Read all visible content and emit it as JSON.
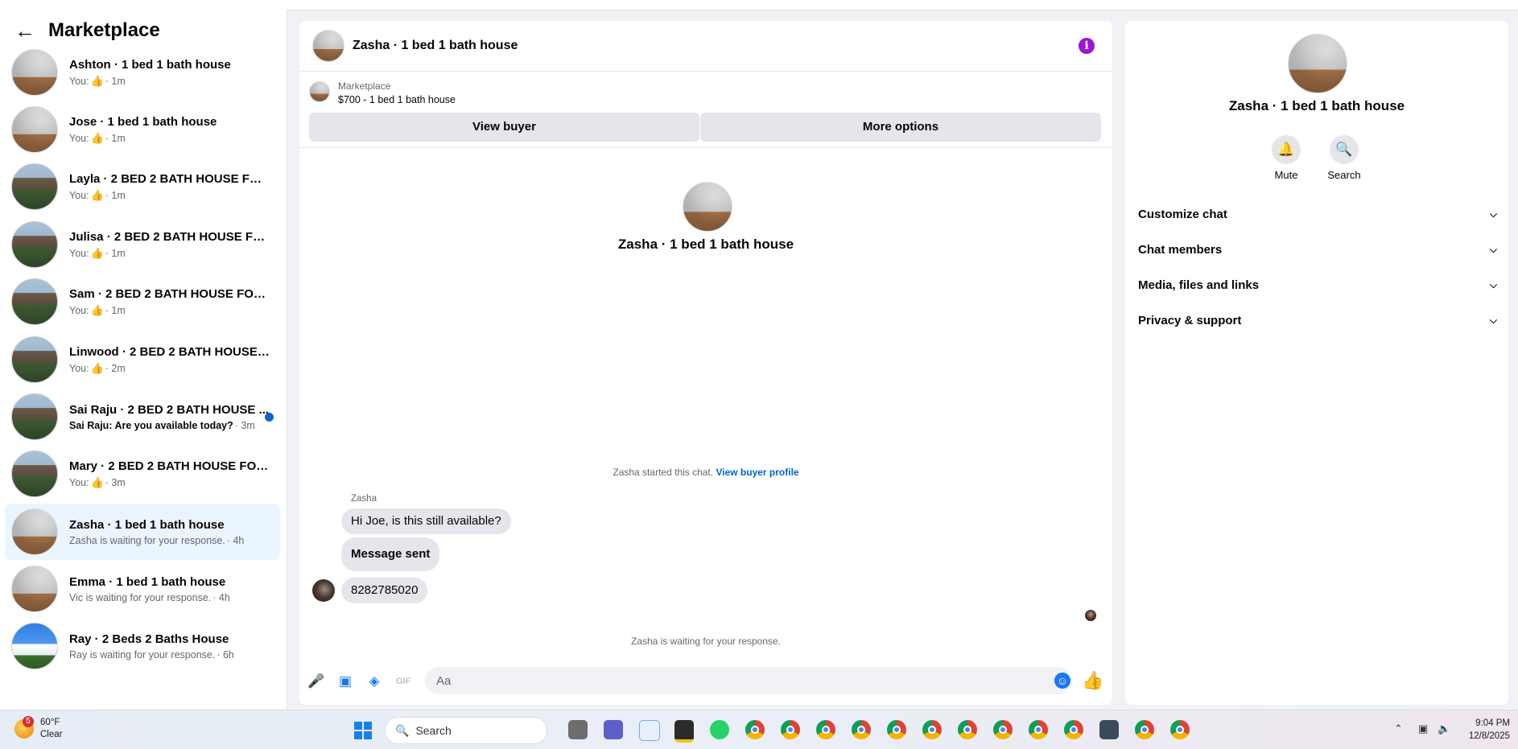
{
  "sidebar": {
    "title": "Marketplace",
    "conversations": [
      {
        "name": "Ashton · 1 bed 1 bath house",
        "prefix": "You:",
        "suffix": "· 1m"
      },
      {
        "name": "Jose · 1 bed 1 bath house",
        "prefix": "You:",
        "suffix": "· 1m"
      },
      {
        "name": "Layla · 2 BED 2 BATH HOUSE FOR ...",
        "prefix": "You:",
        "suffix": "· 1m"
      },
      {
        "name": "Julisa · 2 BED 2 BATH HOUSE FOR ...",
        "prefix": "You:",
        "suffix": "· 1m"
      },
      {
        "name": "Sam · 2 BED 2 BATH HOUSE FOR R...",
        "prefix": "You:",
        "suffix": "· 1m"
      },
      {
        "name": "Linwood · 2 BED 2 BATH HOUSE F...",
        "prefix": "You:",
        "suffix": "· 2m"
      },
      {
        "name": "Sai Raju · 2 BED 2 BATH HOUSE ...",
        "preview": "Sai Raju: Are you available today?",
        "suffix": "· 3m"
      },
      {
        "name": "Mary · 2 BED 2 BATH HOUSE FOR ...",
        "prefix": "You:",
        "suffix": "· 3m"
      },
      {
        "name": "Zasha · 1 bed 1 bath house",
        "preview": "Zasha is waiting for your response.",
        "suffix": "· 4h"
      },
      {
        "name": "Emma · 1 bed 1 bath house",
        "preview": "Vic is waiting for your response.",
        "suffix": "· 4h"
      },
      {
        "name": "Ray · 2 Beds 2 Baths House",
        "preview": "Ray is waiting for your response.",
        "suffix": "· 6h"
      }
    ]
  },
  "chat": {
    "title": "Zasha · 1 bed 1 bath house",
    "listing_label": "Marketplace",
    "listing_price": "$700 - 1 bed 1 bath house",
    "view_buyer": "View buyer",
    "more_options": "More options",
    "center_title": "Zasha · 1 bed 1 bath house",
    "started_text": "Zasha started this chat.",
    "view_buyer_profile": "View buyer profile",
    "sender": "Zasha",
    "messages": [
      "Hi Joe, is this still available?",
      "Message sent",
      "8282785020"
    ],
    "waiting_text": "Zasha is waiting for your response.",
    "input_placeholder": "Aa"
  },
  "details": {
    "title": "Zasha · 1 bed 1 bath house",
    "mute": "Mute",
    "search": "Search",
    "sections": [
      "Customize chat",
      "Chat members",
      "Media, files and links",
      "Privacy & support"
    ]
  },
  "taskbar": {
    "weather_badge": "5",
    "temperature": "60°F",
    "condition": "Clear",
    "search_label": "Search",
    "time": "9:04 PM",
    "date": "12/8/2025"
  },
  "colors": {
    "accent": "#1877f2",
    "active_row": "#ebf5ff",
    "info": "#9b16d6",
    "unread": "#0a66d6"
  }
}
